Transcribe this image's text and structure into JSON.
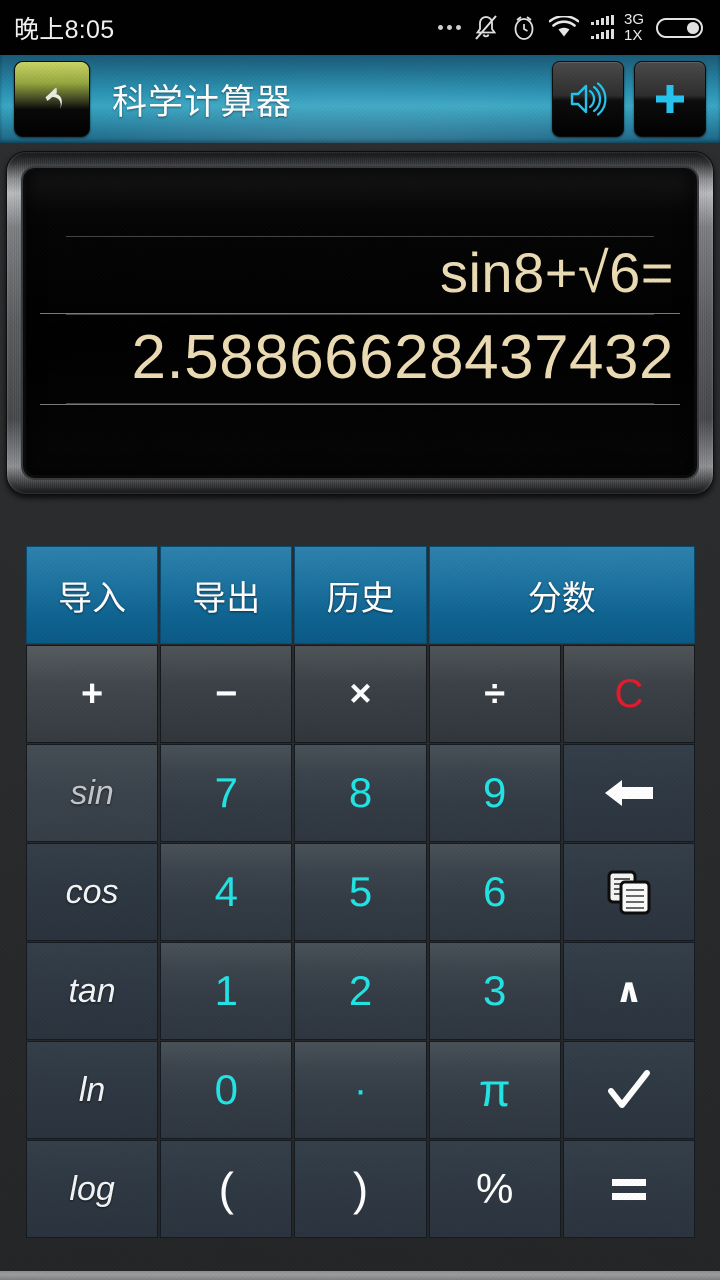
{
  "statusbar": {
    "time": "晚上8:05",
    "icons": [
      {
        "name": "more-dots-icon"
      },
      {
        "name": "silent-bell-icon"
      },
      {
        "name": "alarm-clock-icon"
      },
      {
        "name": "wifi-icon"
      },
      {
        "name": "signal-bars-icon"
      },
      {
        "name": "battery-icon"
      }
    ],
    "network_primary": "3G",
    "network_secondary": "1X"
  },
  "appbar": {
    "back_label": "back-arrow",
    "title": "科学计算器",
    "sound_label": "sound",
    "add_label": "+"
  },
  "display": {
    "expression": "sin8+√6=",
    "result": "2.58866628437432",
    "text_color": "#ecdcb4"
  },
  "keypad": {
    "rows": [
      [
        {
          "label": "导入",
          "name": "import-button",
          "style": "blue",
          "span": 1
        },
        {
          "label": "导出",
          "name": "export-button",
          "style": "blue",
          "span": 1
        },
        {
          "label": "历史",
          "name": "history-button",
          "style": "blue",
          "span": 1
        },
        {
          "label": "分数",
          "name": "fraction-button",
          "style": "blue",
          "span": 2
        }
      ],
      [
        {
          "label": "+",
          "name": "plus-button",
          "style": "op-first"
        },
        {
          "label": "−",
          "name": "minus-button",
          "style": "op"
        },
        {
          "label": "×",
          "name": "multiply-button",
          "style": "op"
        },
        {
          "label": "÷",
          "name": "divide-button",
          "style": "op"
        },
        {
          "label": "C",
          "name": "clear-button",
          "style": "clear"
        }
      ],
      [
        {
          "label": "sin",
          "name": "sin-button",
          "style": "fn-dim"
        },
        {
          "label": "7",
          "name": "digit-7-button",
          "style": "num"
        },
        {
          "label": "8",
          "name": "digit-8-button",
          "style": "num"
        },
        {
          "label": "9",
          "name": "digit-9-button",
          "style": "num"
        },
        {
          "label": "",
          "name": "backspace-button",
          "style": "icon-backspace"
        }
      ],
      [
        {
          "label": "cos",
          "name": "cos-button",
          "style": "fn"
        },
        {
          "label": "4",
          "name": "digit-4-button",
          "style": "num"
        },
        {
          "label": "5",
          "name": "digit-5-button",
          "style": "num"
        },
        {
          "label": "6",
          "name": "digit-6-button",
          "style": "num"
        },
        {
          "label": "",
          "name": "copy-button",
          "style": "icon-copy"
        }
      ],
      [
        {
          "label": "tan",
          "name": "tan-button",
          "style": "fn"
        },
        {
          "label": "1",
          "name": "digit-1-button",
          "style": "num"
        },
        {
          "label": "2",
          "name": "digit-2-button",
          "style": "num"
        },
        {
          "label": "3",
          "name": "digit-3-button",
          "style": "num"
        },
        {
          "label": "∧",
          "name": "power-button",
          "style": "caret"
        }
      ],
      [
        {
          "label": "ln",
          "name": "ln-button",
          "style": "fn"
        },
        {
          "label": "0",
          "name": "digit-0-button",
          "style": "num"
        },
        {
          "label": "·",
          "name": "decimal-point-button",
          "style": "dot"
        },
        {
          "label": "π",
          "name": "pi-button",
          "style": "pi"
        },
        {
          "label": "",
          "name": "sqrt-button",
          "style": "icon-check"
        }
      ],
      [
        {
          "label": "log",
          "name": "log-button",
          "style": "fn"
        },
        {
          "label": "(",
          "name": "left-paren-button",
          "style": "dark"
        },
        {
          "label": ")",
          "name": "right-paren-button",
          "style": "dark"
        },
        {
          "label": "%",
          "name": "percent-button",
          "style": "dark"
        },
        {
          "label": "",
          "name": "equals-button",
          "style": "icon-equals"
        }
      ]
    ]
  },
  "colors": {
    "accent_blue": "#1d73a0",
    "digit_cyan": "#22e4e4",
    "clear_red": "#e7192b",
    "display_text": "#ecdcb4"
  }
}
